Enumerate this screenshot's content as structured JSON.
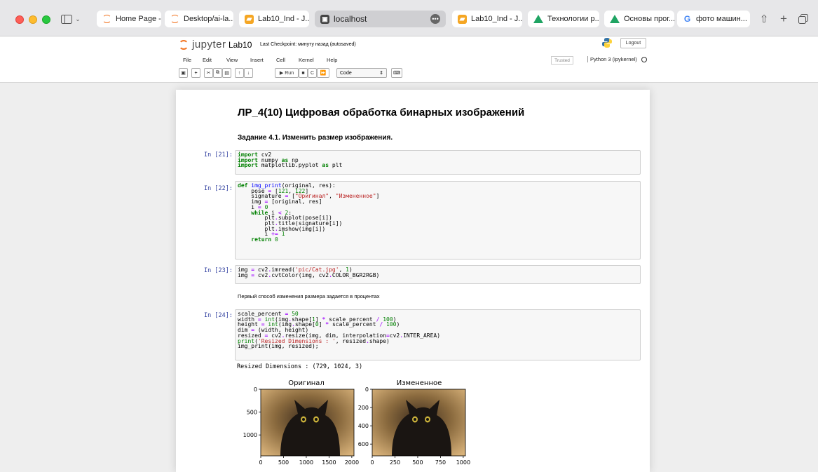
{
  "browser": {
    "tabs": [
      {
        "label": "Home Page -...",
        "icon": "jupyter-icon"
      },
      {
        "label": "Desktop/ai-la...",
        "icon": "jupyter-icon"
      },
      {
        "label": "Lab10_Ind - J...",
        "icon": "lab-icon"
      },
      {
        "label": "localhost",
        "icon": "localhost-icon"
      },
      {
        "label": "Lab10_Ind - J...",
        "icon": "lab-icon"
      },
      {
        "label": "Технологии р...",
        "icon": "drive-icon"
      },
      {
        "label": "Основы прог...",
        "icon": "drive-icon"
      },
      {
        "label": "фото машин...",
        "icon": "google-icon"
      }
    ]
  },
  "jupyter": {
    "logo_text": "jupyter",
    "notebook_name": "Lab10",
    "checkpoint": "Last Checkpoint: минуту назад  (autosaved)",
    "logout_label": "Logout",
    "menu": [
      "File",
      "Edit",
      "View",
      "Insert",
      "Cell",
      "Kernel",
      "Help"
    ],
    "trusted_label": "Trusted",
    "kernel_label": "Python 3 (ipykernel)",
    "run_label": "Run",
    "cell_type": "Code"
  },
  "notebook": {
    "heading": "ЛР_4(10) Цифровая обработка бинарных изображений",
    "subheading": "Задание 4.1. Изменить размер изображения.",
    "prompts": [
      "In [21]:",
      "In [22]:",
      "In [23]:",
      "In [24]:"
    ],
    "markdown_1": "Первый способ изменения размера задается в процентах",
    "output_text": "Resized Dimensions :  (729, 1024, 3)"
  },
  "chart_data": [
    {
      "type": "image",
      "title": "Оригинал",
      "x_ticks": [
        "0",
        "500",
        "1000",
        "1500",
        "2000"
      ],
      "y_ticks": [
        "0",
        "500",
        "1000"
      ],
      "xlim": [
        0,
        2048
      ],
      "ylim": [
        1458,
        0
      ]
    },
    {
      "type": "image",
      "title": "Измененное",
      "x_ticks": [
        "0",
        "250",
        "500",
        "750",
        "1000"
      ],
      "y_ticks": [
        "0",
        "200",
        "400",
        "600"
      ],
      "xlim": [
        0,
        1024
      ],
      "ylim": [
        729,
        0
      ]
    }
  ]
}
